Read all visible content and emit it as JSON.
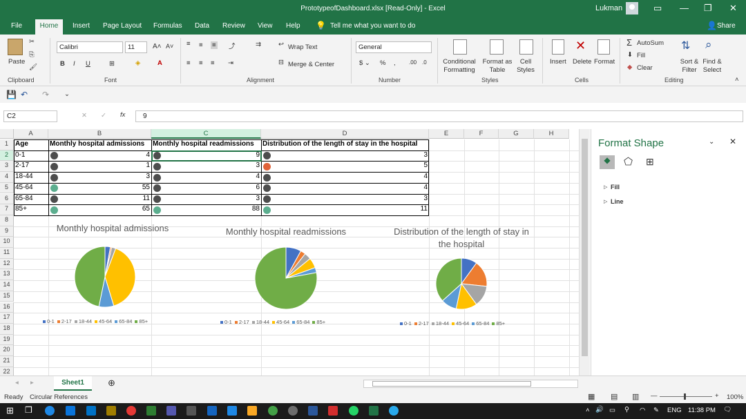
{
  "window": {
    "title": "PrototypeofDashboard.xlsx  [Read-Only]  -  Excel",
    "user": "Lukman"
  },
  "menu": {
    "file": "File",
    "home": "Home",
    "insert": "Insert",
    "page_layout": "Page Layout",
    "formulas": "Formulas",
    "data": "Data",
    "review": "Review",
    "view": "View",
    "help": "Help",
    "tell_me": "Tell me what you want to do",
    "share": "Share"
  },
  "ribbon": {
    "paste": "Paste",
    "clipboard": "Clipboard",
    "font_group": "Font",
    "font_name": "Calibri",
    "font_size": "11",
    "wrap_text": "Wrap Text",
    "merge_center": "Merge & Center",
    "alignment": "Alignment",
    "number_format": "General",
    "number_group": "Number",
    "conditional_formatting": "Conditional\nFormatting",
    "format_as_table": "Format as\nTable",
    "cell_styles": "Cell\nStyles",
    "styles_group": "Styles",
    "insert": "Insert",
    "delete": "Delete",
    "format": "Format",
    "cells_group": "Cells",
    "autosum": "AutoSum",
    "fill": "Fill",
    "clear": "Clear",
    "sort_filter": "Sort &\nFilter",
    "find_select": "Find &\nSelect",
    "editing_group": "Editing"
  },
  "formula_bar": {
    "name_box": "C2",
    "fx": "fx",
    "content": "9"
  },
  "columns": [
    "A",
    "B",
    "C",
    "D",
    "E",
    "F",
    "G",
    "H"
  ],
  "rows": [
    "1",
    "2",
    "3",
    "4",
    "5",
    "6",
    "7",
    "8",
    "9",
    "10",
    "11",
    "12",
    "13",
    "14",
    "15",
    "16",
    "17",
    "18",
    "19",
    "20",
    "21",
    "22"
  ],
  "table": {
    "headers": [
      "Age",
      "Monthly hospital admissions",
      "Monthly hospital readmissions",
      "Distribution of the length of stay in the hospital"
    ],
    "rows": [
      {
        "age": "0-1",
        "b": "4",
        "c": "9",
        "d": "3"
      },
      {
        "age": "2-17",
        "b": "1",
        "c": "3",
        "d": "5"
      },
      {
        "age": "18-44",
        "b": "3",
        "c": "4",
        "d": "4"
      },
      {
        "age": "45-64",
        "b": "55",
        "c": "6",
        "d": "4"
      },
      {
        "age": "65-84",
        "b": "11",
        "c": "3",
        "d": "3"
      },
      {
        "age": "85+",
        "b": "65",
        "c": "88",
        "d": "11"
      }
    ],
    "icon_colors": {
      "b": [
        "#4d4d4d",
        "#4d4d4d",
        "#4d4d4d",
        "#5cae8f",
        "#4d4d4d",
        "#5cae8f"
      ],
      "c": [
        "#4d4d4d",
        "#4d4d4d",
        "#4d4d4d",
        "#4d4d4d",
        "#4d4d4d",
        "#5cae8f"
      ],
      "d": [
        "#4d4d4d",
        "#e0633a",
        "#4d4d4d",
        "#4d4d4d",
        "#4d4d4d",
        "#5cae8f"
      ]
    }
  },
  "chart_data": [
    {
      "type": "pie",
      "title": "Monthly hospital admissions",
      "categories": [
        "0-1",
        "2-17",
        "18-44",
        "45-64",
        "65-84",
        "85+"
      ],
      "values": [
        4,
        1,
        3,
        55,
        11,
        65
      ],
      "colors": [
        "#4472c4",
        "#ed7d31",
        "#a5a5a5",
        "#ffc000",
        "#5b9bd5",
        "#70ad47"
      ],
      "legend": "bottom"
    },
    {
      "type": "pie",
      "title": "Monthly hospital readmissions",
      "categories": [
        "0-1",
        "2-17",
        "18-44",
        "45-64",
        "65-84",
        "85+"
      ],
      "values": [
        9,
        3,
        4,
        6,
        3,
        88
      ],
      "colors": [
        "#4472c4",
        "#ed7d31",
        "#a5a5a5",
        "#ffc000",
        "#5b9bd5",
        "#70ad47"
      ],
      "legend": "bottom"
    },
    {
      "type": "pie",
      "title": "Distribution of the length of stay in the hospital",
      "categories": [
        "0-1",
        "2-17",
        "18-44",
        "45-64",
        "65-84",
        "85+"
      ],
      "values": [
        3,
        5,
        4,
        4,
        3,
        11
      ],
      "colors": [
        "#4472c4",
        "#ed7d31",
        "#a5a5a5",
        "#ffc000",
        "#5b9bd5",
        "#70ad47"
      ],
      "legend": "bottom"
    }
  ],
  "format_pane": {
    "title": "Format Shape",
    "fill": "Fill",
    "line": "Line"
  },
  "sheet_tab": "Sheet1",
  "status": {
    "ready": "Ready",
    "circular": "Circular References",
    "zoom": "100%"
  },
  "taskbar": {
    "lang": "ENG",
    "time": "11:38 PM"
  }
}
